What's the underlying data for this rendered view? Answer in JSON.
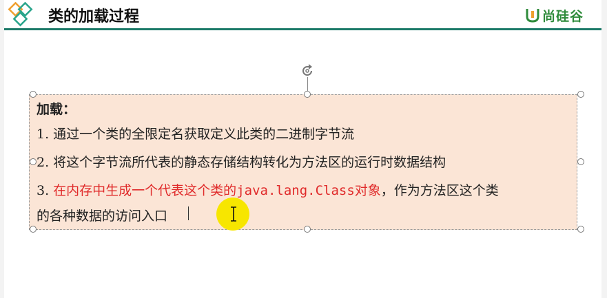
{
  "header": {
    "title": "类的加载过程",
    "logo_text": "尚硅谷"
  },
  "content": {
    "heading": "加载：",
    "line1": "1. 通过一个类的全限定名获取定义此类的二进制字节流",
    "line2": "2. 将这个字节流所代表的静态存储结构转化为方法区的运行时数据结构",
    "line3_num": "3. ",
    "line3_red_a": "在内存中生成一个代表这个类的",
    "line3_red_code": "java.lang.Class",
    "line3_red_b": "对象",
    "line3_rest": "，作为方法区这个类",
    "line4": "的各种数据的访问入口"
  },
  "colors": {
    "accent": "#1c7a68",
    "textbox_fill": "#fbe5d6",
    "highlight_red": "#e02b2b",
    "cursor_highlight": "#f7e600",
    "logo_green": "#2f8b3b"
  },
  "icons": {
    "header_decor": "diamonds-icon",
    "logo": "atguigu-logo-icon",
    "rotate": "rotate-handle-icon",
    "cursor": "ibeam-cursor-icon"
  }
}
